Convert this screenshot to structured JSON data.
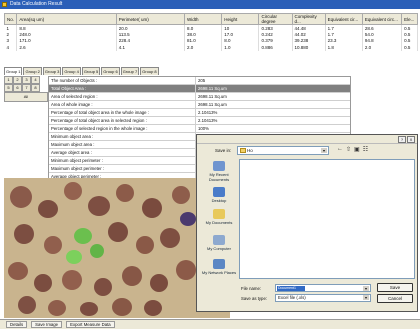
{
  "window": {
    "title": "Data Calculation Result"
  },
  "results": {
    "headers": [
      "No.",
      "Area(sq um)",
      "Perimeter( um)",
      "Width",
      "Height",
      "Circular degree",
      "Complexity d...",
      "Equivalent cir...",
      "Equivalent circ...",
      "Ele..."
    ],
    "rows": [
      [
        "1",
        "8.8",
        "20.0",
        "8.0",
        "10",
        "0.283",
        "44.48",
        "1.7",
        "28.6",
        "0.5"
      ],
      [
        "2",
        "248.0",
        "113.5",
        "38.0",
        "17.0",
        "0.242",
        "44.02",
        "1.7",
        "54.0",
        "0.5"
      ],
      [
        "3",
        "171.0",
        "228.4",
        "81.0",
        "8.0",
        "0.379",
        "39.238",
        "23.3",
        "94.8",
        "0.5"
      ],
      [
        "4",
        "2.6",
        "4.1",
        "2.0",
        "1.0",
        "0.886",
        "10.880",
        "1.8",
        "2.0",
        "0.5"
      ]
    ]
  },
  "tabs": [
    "Group 1",
    "Group 2",
    "Group 3",
    "Group 4",
    "Group 5",
    "Group 6",
    "Group 7",
    "Group 8"
  ],
  "grid": {
    "row1": [
      "1",
      "2",
      "3",
      "4"
    ],
    "row2": [
      "5",
      "6",
      "7",
      "8"
    ],
    "all_label": "All"
  },
  "properties": [
    {
      "label": "The number of Objects :",
      "value": "205"
    },
    {
      "label": "Total Object Area :",
      "value": "2698.11 Sq.um",
      "highlight": true
    },
    {
      "label": "Area of selected region :",
      "value": "2698.11 Sq.um"
    },
    {
      "label": "Area of whole image :",
      "value": "2698.11 Sq.um"
    },
    {
      "label": "Percentage of total object area in the whole image :",
      "value": "2.10413%"
    },
    {
      "label": "Percentage of total object area in selected region :",
      "value": "2.10413%"
    },
    {
      "label": "Percentage of selected region in the whole image :",
      "value": "100%"
    },
    {
      "label": "Minimum object area :",
      "value": ""
    },
    {
      "label": "Maximum object area :",
      "value": ""
    },
    {
      "label": "Average object area :",
      "value": ""
    },
    {
      "label": "Minimum object perimeter :",
      "value": ""
    },
    {
      "label": "Maximum object perimeter :",
      "value": ""
    },
    {
      "label": "Average object perimeter :",
      "value": ""
    }
  ],
  "statusbar": {
    "items": [
      "Details",
      "Save Image",
      "Export Measure Data"
    ]
  },
  "dialog": {
    "savein_label": "Save in:",
    "savein_value": "Ho",
    "places": [
      "My Recent Documents",
      "Desktop",
      "My Documents",
      "My Computer",
      "My Network Places"
    ],
    "filename_label": "File name:",
    "filename_value": "Document1",
    "savetype_label": "Save as type:",
    "savetype_value": "Excel file (.xls)",
    "save_label": "Save",
    "cancel_label": "Cancel",
    "help_label": "?",
    "close_label": "X"
  },
  "colors": {
    "titlebar": "#2b5fb8",
    "selection": "#316ac5",
    "highlight_row": "#808080",
    "sample_background": "#c9b48e"
  }
}
